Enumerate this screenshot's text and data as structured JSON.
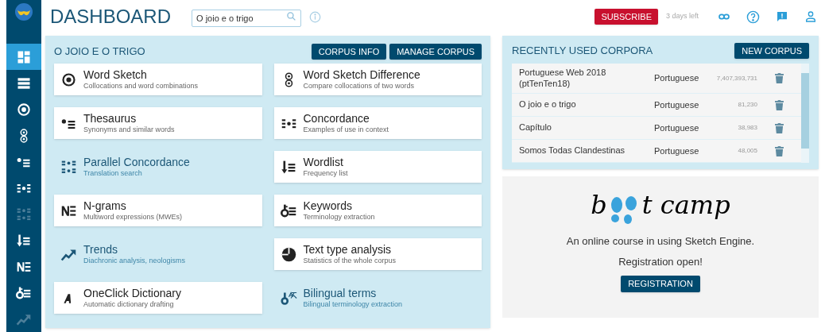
{
  "header": {
    "title": "DASHBOARD",
    "search": {
      "value": "O joio e o trigo"
    },
    "subscribe": "SUBSCRIBE",
    "trial": "3 days left"
  },
  "sidebar": {
    "items": [
      {
        "kind": "dashboard",
        "selected": true,
        "disabled": false
      },
      {
        "kind": "corpora",
        "selected": false,
        "disabled": false
      },
      {
        "kind": "wordsketch",
        "selected": false,
        "disabled": false
      },
      {
        "kind": "wsdiff",
        "selected": false,
        "disabled": false
      },
      {
        "kind": "thesaurus",
        "selected": false,
        "disabled": false
      },
      {
        "kind": "concordance",
        "selected": false,
        "disabled": false
      },
      {
        "kind": "parallel",
        "selected": false,
        "disabled": true
      },
      {
        "kind": "wordlist",
        "selected": false,
        "disabled": false
      },
      {
        "kind": "ngrams",
        "selected": false,
        "disabled": false
      },
      {
        "kind": "keywords",
        "selected": false,
        "disabled": false
      },
      {
        "kind": "trends",
        "selected": false,
        "disabled": true
      }
    ]
  },
  "corpus_panel": {
    "title": "O JOIO E O TRIGO",
    "buttons": [
      "CORPUS INFO",
      "MANAGE CORPUS"
    ],
    "tools": [
      {
        "kind": "wordsketch",
        "name": "Word Sketch",
        "description": "Collocations and word combinations",
        "available": true
      },
      {
        "kind": "wsdiff",
        "name": "Word Sketch Difference",
        "description": "Compare collocations of two words",
        "available": true
      },
      {
        "kind": "thesaurus",
        "name": "Thesaurus",
        "description": "Synonyms and similar words",
        "available": true
      },
      {
        "kind": "concordance",
        "name": "Concordance",
        "description": "Examples of use in context",
        "available": true
      },
      {
        "kind": "parallel",
        "name": "Parallel Concordance",
        "description": "Translation search",
        "available": false
      },
      {
        "kind": "wordlist",
        "name": "Wordlist",
        "description": "Frequency list",
        "available": true
      },
      {
        "kind": "ngrams",
        "name": "N-grams",
        "description": "Multiword expressions (MWEs)",
        "available": true
      },
      {
        "kind": "keywords",
        "name": "Keywords",
        "description": "Terminology extraction",
        "available": true
      },
      {
        "kind": "trends",
        "name": "Trends",
        "description": "Diachronic analysis, neologisms",
        "available": false
      },
      {
        "kind": "texttype",
        "name": "Text type analysis",
        "description": "Statistics of the whole corpus",
        "available": true
      },
      {
        "kind": "oneclick",
        "name": "OneClick Dictionary",
        "description": "Automatic dictionary drafting",
        "available": true
      },
      {
        "kind": "bilingual",
        "name": "Bilingual terms",
        "description": "Bilingual terminology extraction",
        "available": false
      }
    ]
  },
  "recent_corpora": {
    "title": "RECENTLY USED CORPORA",
    "button": "NEW CORPUS",
    "rows": [
      {
        "name": "Portuguese Web 2018 (ptTenTen18)",
        "language": "Portuguese",
        "size": "7,407,393,731"
      },
      {
        "name": "O joio e o trigo",
        "language": "Portuguese",
        "size": "81,230"
      },
      {
        "name": "Capítulo",
        "language": "Portuguese",
        "size": "38,983"
      },
      {
        "name": "Somos Todas Clandestinas",
        "language": "Portuguese",
        "size": "48,005"
      }
    ]
  },
  "bootcamp": {
    "logo_start": "b",
    "logo_end": "t camp",
    "text": "An online course in using Sketch Engine.",
    "text2": "Registration open!",
    "button": "REGISTRATION"
  }
}
